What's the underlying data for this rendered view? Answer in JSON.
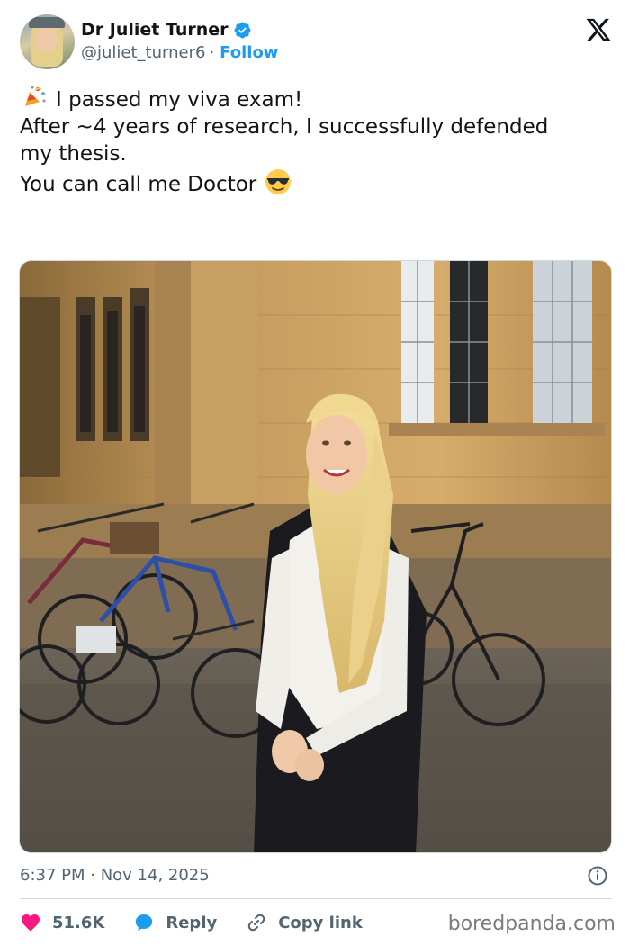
{
  "author": {
    "display_name": "Dr Juliet Turner",
    "handle": "@juliet_turner6",
    "separator": "·",
    "follow_label": "Follow",
    "verified": true
  },
  "post": {
    "lines": [
      "I passed my viva exam!",
      "",
      "After ~4 years of research, I successfully defended",
      "my thesis.",
      "",
      "You can call me Doctor"
    ],
    "icons": [
      "party-popper-emoji",
      "sunglasses-emoji"
    ]
  },
  "media": {
    "kind": "photo"
  },
  "meta": {
    "timestamp": "6:37 PM · Nov 14, 2025"
  },
  "actions": {
    "likes": "51.6K",
    "reply_label": "Reply",
    "copy_label": "Copy link"
  },
  "watermark": "boredpanda.com",
  "colors": {
    "accent": "#1d9bf0",
    "like": "#f91880",
    "text": "#0f1419",
    "muted": "#536471"
  }
}
